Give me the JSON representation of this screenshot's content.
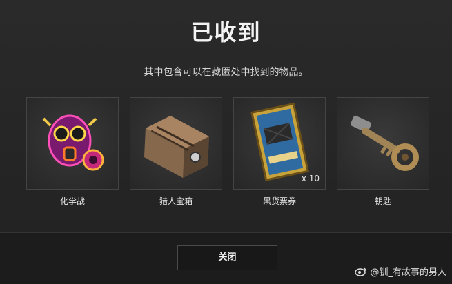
{
  "dialog": {
    "title": "已收到",
    "subtitle": "其中包含可以在藏匿处中找到的物品。",
    "close_label": "关闭"
  },
  "items": [
    {
      "label": "化学战",
      "icon": "gas-mask-icon",
      "count": ""
    },
    {
      "label": "猎人宝箱",
      "icon": "hunter-chest-icon",
      "count": ""
    },
    {
      "label": "黑货票券",
      "icon": "contraband-coupon-icon",
      "count": "x 10"
    },
    {
      "label": "钥匙",
      "icon": "key-icon",
      "count": ""
    }
  ],
  "watermark": {
    "text": "@钏_有故事的男人",
    "icon": "weibo-logo"
  },
  "colors": {
    "background": "#262626",
    "footer": "#1c1c1c",
    "tile_border": "#444444"
  }
}
